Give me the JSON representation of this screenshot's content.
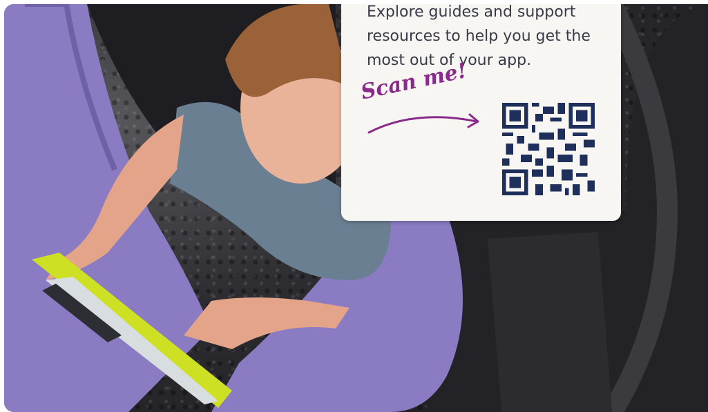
{
  "card": {
    "description": "Explore guides and support resources to help you get the most out of your app.",
    "scan_label": "Scan me!"
  },
  "colors": {
    "card_bg": "#f7f6f2",
    "text": "#3a3a4a",
    "accent": "#8a2a8a",
    "qr": "#1f2f5c",
    "tire_purple": "#8a7bc2",
    "tire_black": "#1e1e22",
    "tablet_green": "#cde024"
  },
  "icons": [
    "qr-code-icon",
    "curved-arrow-icon"
  ]
}
